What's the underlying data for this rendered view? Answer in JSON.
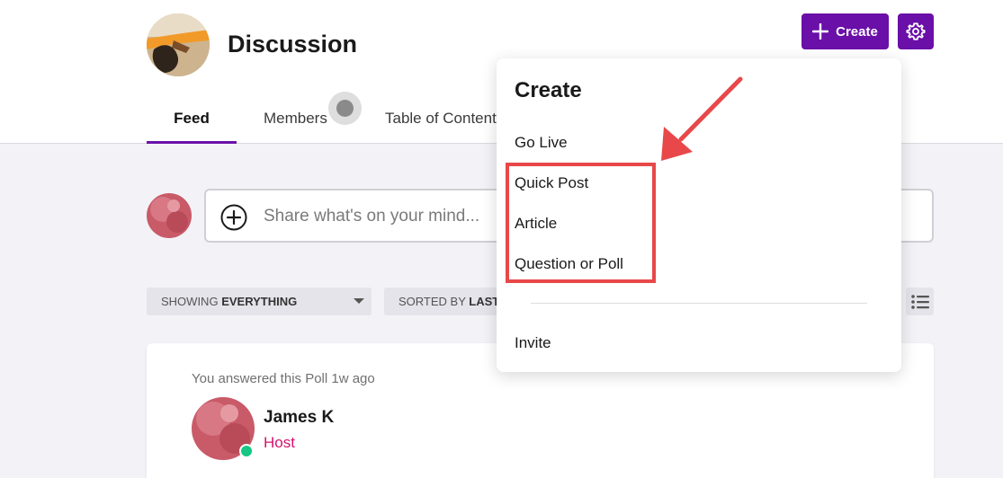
{
  "header": {
    "title": "Discussion",
    "create_label": "Create",
    "create_icon": "plus-icon",
    "settings_icon": "gear-icon",
    "brand_color": "#6a0fa8"
  },
  "tabs": [
    {
      "label": "Feed",
      "active": true
    },
    {
      "label": "Members",
      "active": false
    },
    {
      "label": "Table of Contents",
      "active": false
    }
  ],
  "composer": {
    "placeholder": "Share what's on your mind...",
    "icon": "add-circle-icon"
  },
  "filters": {
    "showing_prefix": "SHOWING",
    "showing_value": "EVERYTHING",
    "sorted_prefix": "SORTED BY",
    "sorted_value": "LAST",
    "list_view_icon": "list-view-icon"
  },
  "post": {
    "activity": "You answered this Poll 1w ago",
    "author": "James K",
    "role": "Host",
    "role_color": "#d5136f",
    "online_color": "#16c784"
  },
  "create_menu": {
    "title": "Create",
    "items": [
      "Go Live",
      "Quick Post",
      "Article",
      "Question or Poll"
    ],
    "invite": "Invite"
  },
  "annotation": {
    "highlight_color": "#e8484a"
  }
}
